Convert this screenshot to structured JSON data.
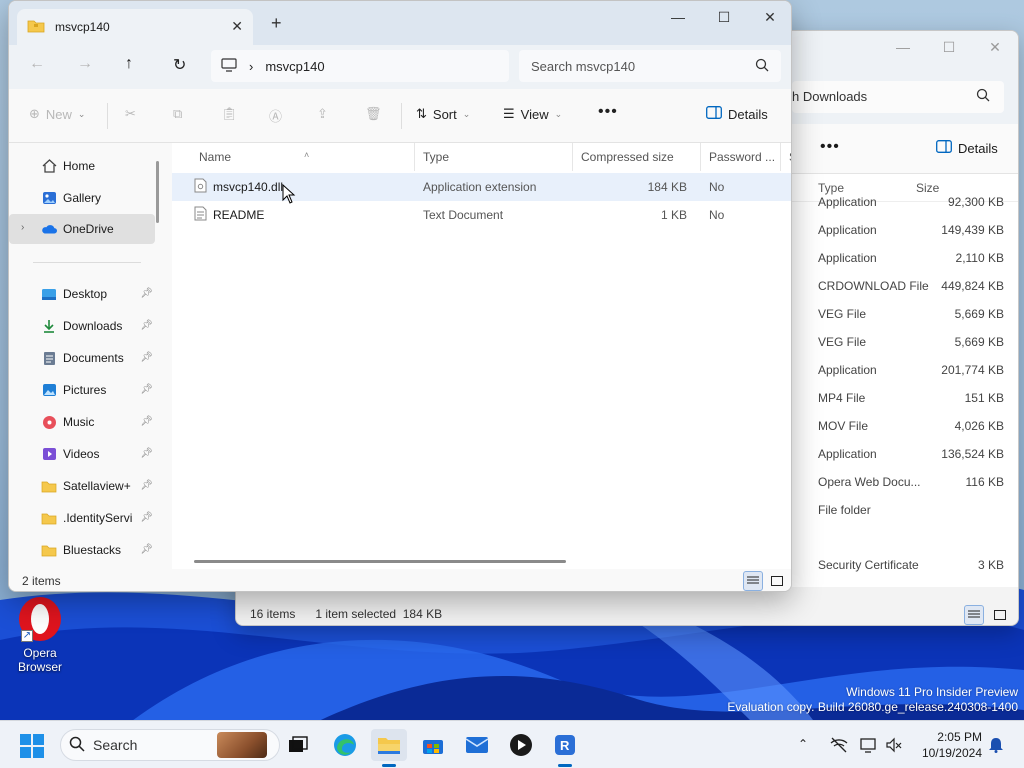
{
  "desktop": {
    "icon_label_line1": "Opera",
    "icon_label_line2": "Browser",
    "watermark_line1": "Windows 11 Pro Insider Preview",
    "watermark_line2": "Evaluation copy. Build 26080.ge_release.240308-1400"
  },
  "back_window": {
    "search_fragment": "h Downloads",
    "details_label": "Details",
    "col_type": "Type",
    "col_size": "Size",
    "rows": [
      {
        "type": "Application",
        "size": "92,300 KB"
      },
      {
        "type": "Application",
        "size": "149,439 KB"
      },
      {
        "type": "Application",
        "size": "2,110 KB"
      },
      {
        "type": "CRDOWNLOAD File",
        "size": "449,824 KB"
      },
      {
        "type": "VEG File",
        "size": "5,669 KB"
      },
      {
        "type": "VEG File",
        "size": "5,669 KB"
      },
      {
        "type": "Application",
        "size": "201,774 KB"
      },
      {
        "type": "MP4 File",
        "size": "151 KB"
      },
      {
        "type": "MOV File",
        "size": "4,026 KB"
      },
      {
        "type": "Application",
        "size": "136,524 KB"
      },
      {
        "type": "Opera Web Docu...",
        "size": "116 KB"
      },
      {
        "type": "File folder",
        "size": ""
      }
    ],
    "last_row": {
      "type": "Security Certificate",
      "size": "3 KB"
    },
    "status_count": "16 items",
    "status_selected": "1 item selected",
    "status_size": "184 KB"
  },
  "window": {
    "tab_title": "msvcp140",
    "breadcrumb": "msvcp140",
    "search_placeholder": "Search msvcp140",
    "toolbar": {
      "new": "New",
      "sort": "Sort",
      "view": "View",
      "details": "Details"
    },
    "nav": {
      "home": "Home",
      "gallery": "Gallery",
      "onedrive": "OneDrive",
      "desktop": "Desktop",
      "downloads": "Downloads",
      "documents": "Documents",
      "pictures": "Pictures",
      "music": "Music",
      "videos": "Videos",
      "satellaview": "Satellaview+",
      "identity": ".IdentityServi",
      "bluestacks": "Bluestacks"
    },
    "columns": {
      "name": "Name",
      "type": "Type",
      "compressed": "Compressed size",
      "password": "Password ...",
      "size": "Si"
    },
    "files": [
      {
        "name": "msvcp140.dll",
        "type": "Application extension",
        "compressed": "184 KB",
        "password": "No"
      },
      {
        "name": "README",
        "type": "Text Document",
        "compressed": "1 KB",
        "password": "No"
      }
    ],
    "status": "2 items"
  },
  "taskbar": {
    "search_label": "Search",
    "time": "2:05 PM",
    "date": "10/19/2024"
  },
  "colors": {
    "accent": "#0067c0",
    "selection": "#e8f0fb"
  }
}
